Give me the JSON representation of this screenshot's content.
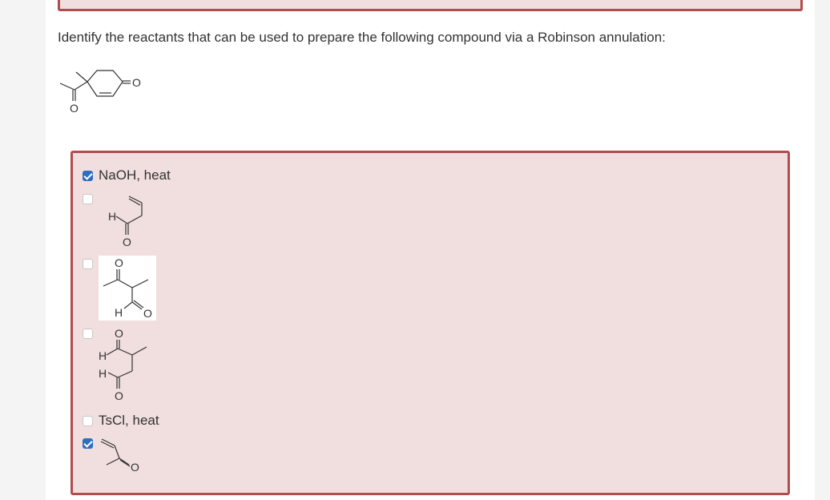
{
  "question": {
    "text": "Identify the reactants that can be used to prepare the following compound via a Robinson annulation:"
  },
  "options": [
    {
      "label": "NaOH, heat",
      "checked": true,
      "kind": "text"
    },
    {
      "label": "",
      "checked": false,
      "kind": "structure",
      "atoms": [
        "H",
        "O"
      ]
    },
    {
      "label": "",
      "checked": false,
      "kind": "structure",
      "atoms": [
        "O",
        "H",
        "O"
      ]
    },
    {
      "label": "",
      "checked": false,
      "kind": "structure",
      "atoms": [
        "O",
        "H",
        "H",
        "O"
      ]
    },
    {
      "label": "TsCl, heat",
      "checked": false,
      "kind": "text"
    },
    {
      "label": "",
      "checked": true,
      "kind": "structure",
      "atoms": [
        "O"
      ]
    }
  ],
  "target_atoms": [
    "O",
    "O"
  ],
  "colors": {
    "error_border": "#b24d4d",
    "error_bg": "#f1dede",
    "checkbox_checked": "#2e6ec0"
  }
}
